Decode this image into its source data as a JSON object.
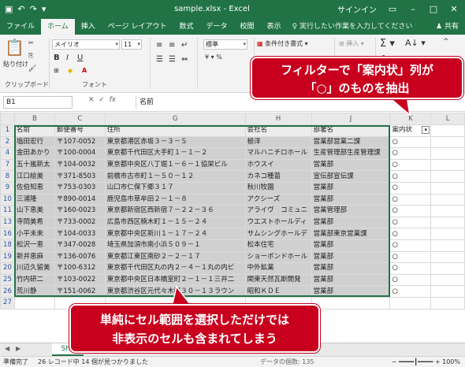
{
  "titlebar": {
    "filename": "sample.xlsx",
    "separator": "-",
    "app": "Excel",
    "signin": "サインイン"
  },
  "tabs": [
    "ファイル",
    "ホーム",
    "挿入",
    "ページ レイアウト",
    "数式",
    "データ",
    "校閲",
    "表示"
  ],
  "tell_me": "実行したい作業を入力してください",
  "share": "共有",
  "ribbon": {
    "paste_label": "貼り付け",
    "clipboard_label": "クリップボード",
    "font_label": "フォント",
    "font_name": "メイリオ",
    "font_size": "11",
    "number_format": "標準",
    "conditional_format": "条件付き書式",
    "insert_label": "挿入"
  },
  "formula_bar": {
    "name_box": "B1",
    "fx": "fx",
    "value": "名前"
  },
  "columns": [
    "A",
    "B",
    "C",
    "G",
    "H",
    "J",
    "K",
    "L"
  ],
  "rows": [
    {
      "num": "1",
      "cells": [
        "名前",
        "郵便番号",
        "住所",
        "会社名",
        "部署名",
        "案内状"
      ]
    },
    {
      "num": "2",
      "cells": [
        "塩田宏行",
        "〒107-0052",
        "東京都港区赤坂３－３－５",
        "極洋",
        "営業部営業二課",
        "○"
      ]
    },
    {
      "num": "4",
      "cells": [
        "金田あかり",
        "〒100-0004",
        "東京都千代田区大手町１－１－２",
        "マルハニチロホール",
        "生産管理部生産管理課",
        "○"
      ]
    },
    {
      "num": "7",
      "cells": [
        "五十嵐新太",
        "〒104-0032",
        "東京都中央区八丁堀１－６－１協栄ビル",
        "ホウスイ",
        "営業部",
        "○"
      ]
    },
    {
      "num": "8",
      "cells": [
        "江口絵美",
        "〒371-8503",
        "前橋市古市町１－５０－１２",
        "カネコ種苗",
        "宣伝部宣伝課",
        "○"
      ]
    },
    {
      "num": "9",
      "cells": [
        "佐伯知恵",
        "〒753-0303",
        "山口市仁保下郷３１７",
        "秋川牧園",
        "営業部",
        "○"
      ]
    },
    {
      "num": "10",
      "cells": [
        "三浦隆",
        "〒890-0014",
        "鹿児島市草牟田２－１－８",
        "アクシーズ",
        "営業部",
        "○"
      ]
    },
    {
      "num": "11",
      "cells": [
        "山下恵美",
        "〒160-0023",
        "東京都新宿区西新宿７－２２－３６",
        "アライヴ　コミュニ",
        "営業管理部",
        "○"
      ]
    },
    {
      "num": "13",
      "cells": [
        "寺岡美希",
        "〒733-0002",
        "広島市西区楠木町１－１５－２４",
        "ウエストホールディ",
        "営業部",
        "○"
      ]
    },
    {
      "num": "16",
      "cells": [
        "小平未来",
        "〒104-0033",
        "東京都中央区新川１－１７－２４",
        "サムシングホールデ",
        "営業部東京営業課",
        "○"
      ]
    },
    {
      "num": "18",
      "cells": [
        "松沢一恵",
        "〒347-0028",
        "埼玉県加須市南小浜５０９－１",
        "松本住宅",
        "営業部",
        "○"
      ]
    },
    {
      "num": "19",
      "cells": [
        "新井恵麻",
        "〒136-0076",
        "東京都江東区南砂２－２－１７",
        "ショーボンドホール",
        "営業部",
        "○"
      ]
    },
    {
      "num": "20",
      "cells": [
        "川辺久留美",
        "〒100-6312",
        "東京都千代田区丸の内２－４－１丸の内ビ",
        "中外鉱業",
        "営業部",
        "○"
      ]
    },
    {
      "num": "25",
      "cells": [
        "竹内研二",
        "〒103-0022",
        "東京都中央区日本橋室町２－１－１三井二",
        "関東天然瓦斯開発",
        "営業部",
        "○"
      ]
    },
    {
      "num": "26",
      "cells": [
        "荒川静",
        "〒151-0062",
        "東京都渋谷区元代々木町３０－１３ラウン",
        "昭和ＫＤＥ",
        "営業部",
        "○"
      ]
    },
    {
      "num": "27",
      "cells": [
        "",
        "",
        "",
        "",
        "",
        ""
      ]
    }
  ],
  "sheet_tab": "She",
  "status": {
    "ready": "準備完了",
    "records": "26 レコード中 14 個が見つかりました",
    "count": "データの個数: 135",
    "zoom": "100%"
  },
  "callouts": {
    "filter": [
      "フィルターで「案内状」列が",
      "「○」のものを抽出"
    ],
    "selection": [
      "単純にセル範囲を選択しただけでは",
      "非表示のセルも含まれてしまう"
    ]
  },
  "colors": {
    "excel_green": "#217346",
    "callout_red": "#c8001e",
    "selection_gray": "#d0d0d0",
    "row_number_blue": "#3153a6"
  },
  "icons": [
    "undo-icon",
    "redo-icon",
    "save-icon",
    "paste-icon",
    "bold-icon",
    "italic-icon",
    "underline-icon",
    "sum-icon",
    "filter-dropdown-icon"
  ]
}
